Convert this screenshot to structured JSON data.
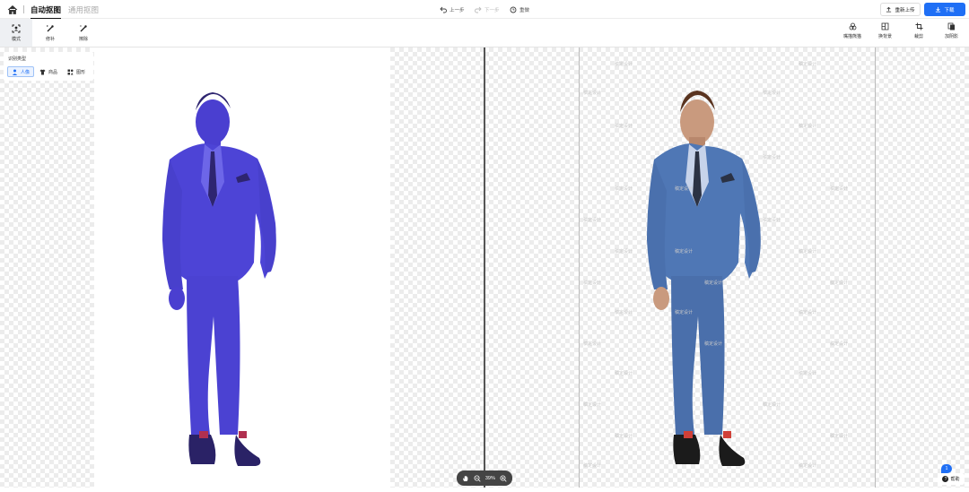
{
  "header": {
    "tabs": [
      {
        "label": "自动抠图",
        "active": true
      },
      {
        "label": "通用抠图",
        "active": false
      }
    ],
    "history": {
      "undo": "上一步",
      "redo": "下一步",
      "reset": "重做"
    },
    "reupload_label": "重新上传",
    "download_label": "下载"
  },
  "toolbar": {
    "left_tools": [
      {
        "label": "模式",
        "icon": "mode-icon",
        "active": true
      },
      {
        "label": "修补",
        "icon": "repair-brush-icon",
        "active": false
      },
      {
        "label": "擦除",
        "icon": "erase-brush-icon",
        "active": false
      }
    ],
    "right_tools": [
      {
        "label": "嘴描熊猫",
        "icon": "effect-icon"
      },
      {
        "label": "换背景",
        "icon": "background-icon"
      },
      {
        "label": "裁剪",
        "icon": "crop-icon"
      },
      {
        "label": "加阴影",
        "icon": "shadow-icon"
      }
    ]
  },
  "recognition": {
    "title": "识别类型",
    "options": [
      {
        "label": "人像",
        "icon": "person-icon",
        "active": true
      },
      {
        "label": "商品",
        "icon": "shirt-icon",
        "active": false
      },
      {
        "label": "图形",
        "icon": "shapes-icon",
        "active": false
      }
    ]
  },
  "watermark_text": "稿定设计",
  "zoom": {
    "level": "39%"
  },
  "help": {
    "label": "帮助",
    "badge": "1"
  },
  "colors": {
    "accent": "#1f6ff5",
    "mask": "#4a3fd0",
    "suit": "#4f77b5"
  }
}
